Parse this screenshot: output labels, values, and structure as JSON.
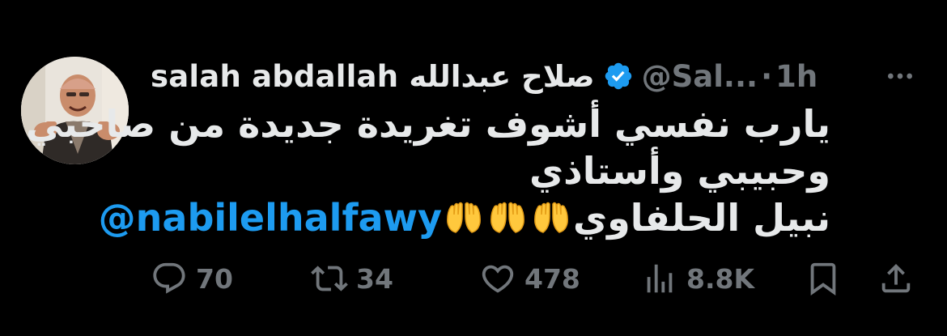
{
  "tweet": {
    "display_name": "salah abdallah صلاح عبدالله",
    "handle": "@Sal...",
    "separator": "·",
    "time": "1h",
    "body_lines": [
      "يارب نفسي أشوف تغريدة جديدة من صاحبي",
      "وحبيبي وأستاذي"
    ],
    "last_line_text": "نبيل الحلفاوي",
    "mention": "@nabilelhalfawy",
    "emoji": [
      "raising-hands-emoji",
      "raising-hands-emoji",
      "raising-hands-emoji"
    ]
  },
  "actions": {
    "reply_count": "70",
    "retweet_count": "34",
    "like_count": "478",
    "views_count": "8.8K"
  },
  "icons": [
    "verified-badge-icon",
    "more-icon",
    "reply-icon",
    "retweet-icon",
    "like-icon",
    "views-icon",
    "bookmark-icon",
    "share-icon"
  ],
  "colors": {
    "background": "#000000",
    "text": "#e7e9ea",
    "secondary": "#71767b",
    "accent": "#1d9bf0"
  }
}
